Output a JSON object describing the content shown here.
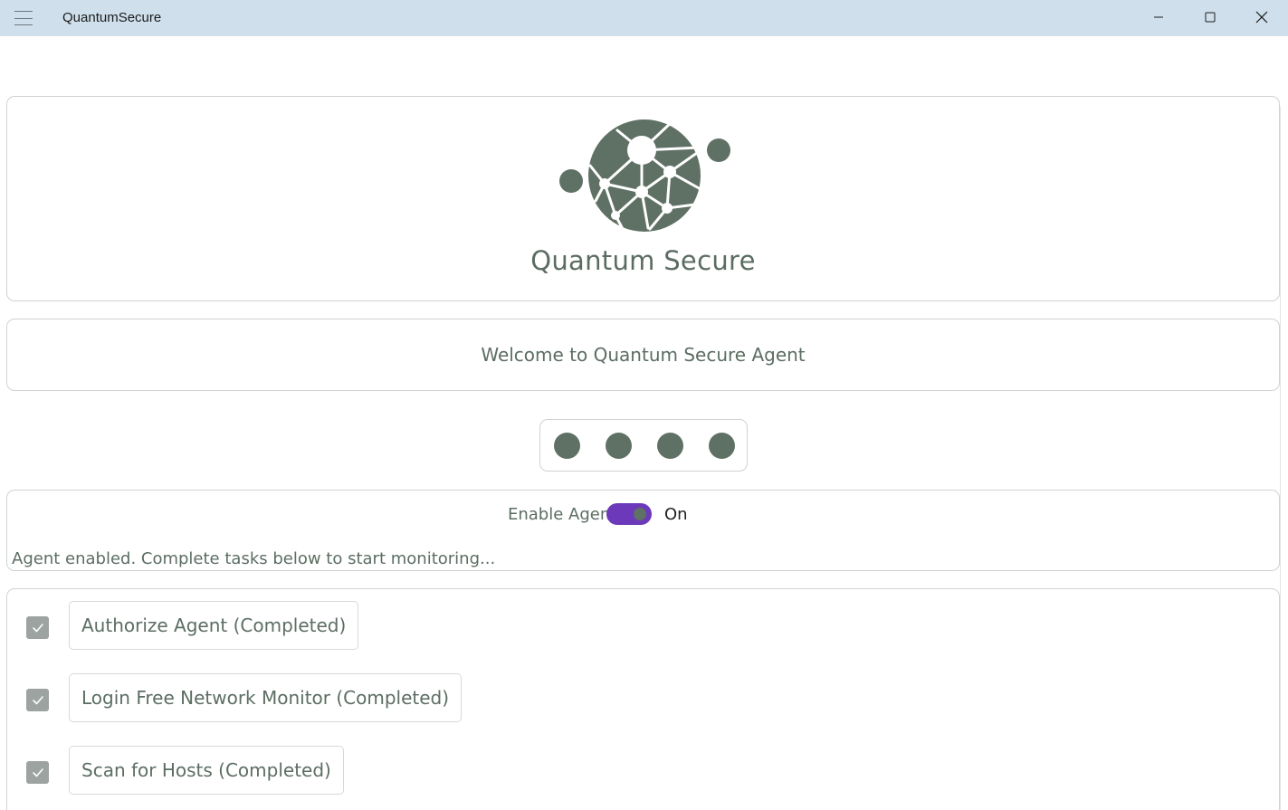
{
  "window": {
    "title": "QuantumSecure"
  },
  "header": {
    "brand_name": "Quantum Secure",
    "welcome": "Welcome to Quantum Secure Agent"
  },
  "progress_dots": {
    "count": 4,
    "color": "#5f7064"
  },
  "agent": {
    "enable_label": "Enable Agent",
    "toggle_on": true,
    "toggle_state_label": "On",
    "toggle_color": "#6b39b9",
    "status": "Agent enabled. Complete tasks below to start monitoring..."
  },
  "tasks": [
    {
      "label": "Authorize Agent (Completed)",
      "checked": true
    },
    {
      "label": "Login Free Network Monitor (Completed)",
      "checked": true
    },
    {
      "label": "Scan for Hosts (Completed)",
      "checked": true
    }
  ],
  "icons": {
    "menu": "hamburger-icon",
    "minimize": "minimize-icon",
    "maximize": "maximize-icon",
    "close": "close-icon",
    "logo": "network-globe-logo",
    "check": "checkmark-icon"
  }
}
